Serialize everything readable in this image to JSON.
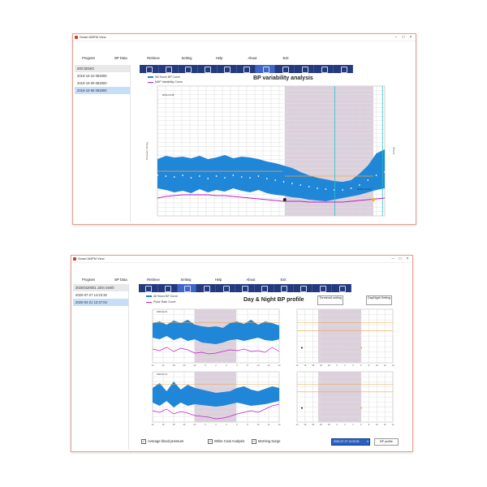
{
  "top": {
    "app_title": "Smart ABPM View",
    "toolbar": [
      {
        "label": "Program",
        "color": "#e85d3a",
        "icon": "person-icon"
      },
      {
        "label": "BP Data",
        "color": "#3e9b42",
        "icon": "data-icon"
      },
      {
        "label": "Retrieve",
        "color": "#f0a025",
        "icon": "retrieve-icon"
      },
      {
        "label": "Setting",
        "color": "#1e9ad6",
        "icon": "gear-icon"
      },
      {
        "label": "Help",
        "color": "#46a639",
        "icon": "help-icon"
      },
      {
        "label": "About",
        "color": "#1e8fd6",
        "icon": "chat-icon"
      },
      {
        "label": "Exit",
        "color": "#e23b3b",
        "icon": "close-icon"
      }
    ],
    "sidebar": [
      "000 DEMO",
      "2019-10-10 093000",
      "2019-10-09 093000",
      "2019-10-08 093000"
    ],
    "selected_index": 3,
    "legend": [
      "SB Hours BP Curve",
      "MAP Variability Curve"
    ],
    "chart_title": "BP variability analysis",
    "ylabel_left": "Pressure mmHg",
    "ylabel_right": "mmHg",
    "date_label": "2019-10-08",
    "annotation": "09:00 morning"
  },
  "bottom": {
    "app_title": "Smart ABPM View",
    "toolbar": [
      {
        "label": "Program",
        "color": "#e85d3a",
        "icon": "person-icon"
      },
      {
        "label": "BP Data",
        "color": "#3e9b42",
        "icon": "data-icon"
      },
      {
        "label": "Retrieve",
        "color": "#f0a025",
        "icon": "retrieve-icon"
      },
      {
        "label": "Setting",
        "color": "#1e9ad6",
        "icon": "gear-icon"
      },
      {
        "label": "Help",
        "color": "#46a639",
        "icon": "help-icon"
      },
      {
        "label": "About",
        "color": "#1e8fd6",
        "icon": "chat-icon"
      },
      {
        "label": "Exit",
        "color": "#e23b3b",
        "icon": "close-icon"
      }
    ],
    "sidebar": [
      "20200420001 John Smith",
      "2020-07-27 14:23:32",
      "2020-04-21 13:37:04"
    ],
    "selected_index": 2,
    "legend": [
      "All Hours BP Curve",
      "Pulse Rate Curve"
    ],
    "chart_title": "Day & Night BP profile",
    "threshold_button": "Threshold setting",
    "daynight_button": "Day/Night Setting",
    "chart1_date": "2020-04-21",
    "chart2_date": "2020-07-27",
    "x_ticks": [
      "14",
      "16",
      "18",
      "20",
      "22",
      "0",
      "2",
      "4",
      "6",
      "8",
      "10",
      "12",
      "14"
    ],
    "checkbox_avg": "Average blood pressure",
    "checkbox_white": "White Coat Analysis",
    "checkbox_morning": "Morning Surge",
    "date_select": "2020-07-27 14:23:32",
    "bp_profile_button": "BP profile",
    "colors": {
      "band": "#1f86d8",
      "pulse": "#c21fc7",
      "threshold": "#f4a546",
      "night": "#d5c8d6"
    }
  }
}
